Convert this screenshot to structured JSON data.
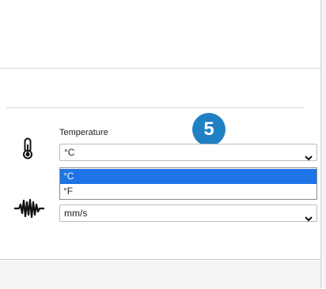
{
  "temperature": {
    "label": "Temperature",
    "selected_value": "°C",
    "options": [
      "°C",
      "°F"
    ],
    "highlighted_option": "°C"
  },
  "vibration": {
    "selected_value": "mm/s"
  },
  "step_badge": "5",
  "colors": {
    "highlight": "#1e74e6",
    "badge": "#1f80c4"
  },
  "icons": {
    "temperature": "thermometer-icon",
    "vibration": "vibration-wave-icon",
    "dropdown": "chevron-down-icon"
  }
}
